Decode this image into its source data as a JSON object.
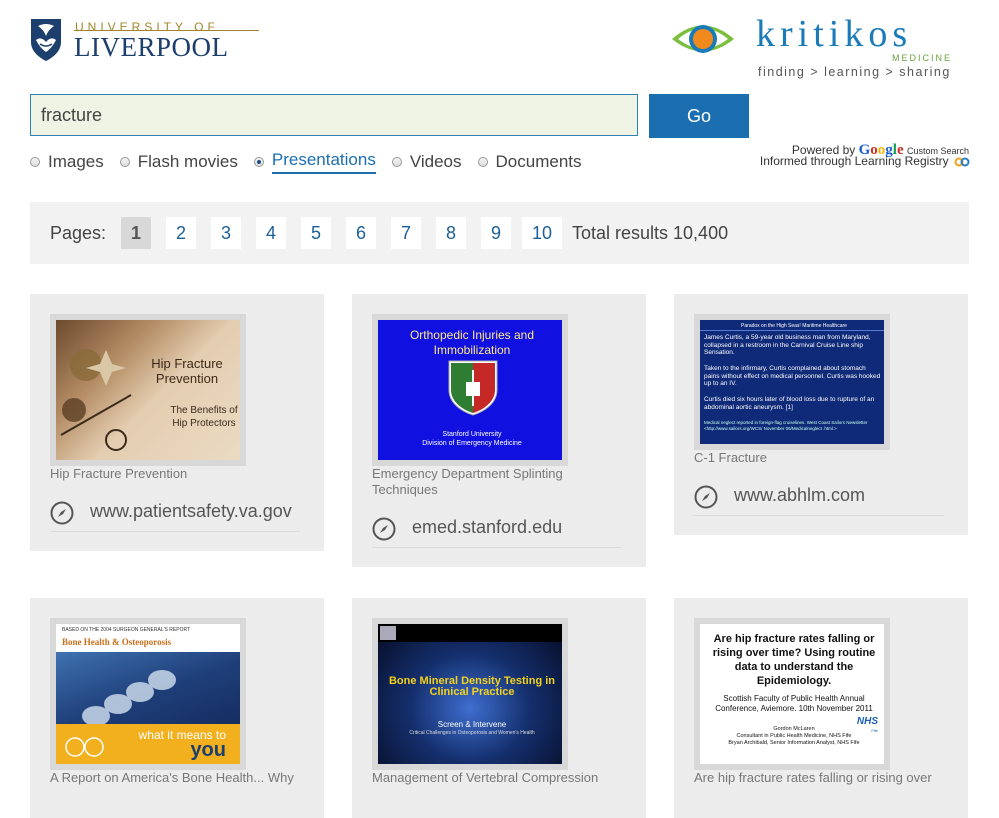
{
  "header": {
    "uol": {
      "top_text": "UNIVERSITY OF",
      "main_text": "LIVERPOOL"
    },
    "kritikos": {
      "word": "kritikos",
      "sub": "MEDICINE",
      "tagline": "finding > learning > sharing"
    }
  },
  "search": {
    "value": "fracture",
    "go_label": "Go"
  },
  "powered": {
    "prefix": "Powered by",
    "google": "Google",
    "custom": "Custom Search",
    "informed": "Informed through Learning Registry"
  },
  "filters": [
    {
      "label": "Images",
      "selected": false
    },
    {
      "label": "Flash movies",
      "selected": false
    },
    {
      "label": "Presentations",
      "selected": true
    },
    {
      "label": "Videos",
      "selected": false
    },
    {
      "label": "Documents",
      "selected": false
    }
  ],
  "pager": {
    "label": "Pages:",
    "pages": [
      "1",
      "2",
      "3",
      "4",
      "5",
      "6",
      "7",
      "8",
      "9",
      "10"
    ],
    "current": "1",
    "total": "Total results 10,400"
  },
  "results": [
    {
      "title": "Hip Fracture Prevention",
      "source": "www.patientsafety.va.gov",
      "slide": {
        "title": "Hip Fracture Prevention",
        "sub": "The Benefits of Hip Protectors"
      }
    },
    {
      "title": "Emergency Department Splinting Techniques",
      "source": "emed.stanford.edu",
      "slide": {
        "title": "Orthopedic Injuries and Immobilization",
        "sub1": "Stanford University",
        "sub2": "Division of Emergency Medicine"
      }
    },
    {
      "title": "C-1 Fracture",
      "source": "www.abhlm.com",
      "slide": {
        "header": "Paradox on the High Seas!   Maritime Healthcare",
        "p1": "James Curtis, a 59-year old business man from Maryland, collapsed in a restroom in the Carnival Cruise Line ship Sensation.",
        "p2": "Taken to the infirmary, Curtis complained about stomach pains without effect on medical personnel.  Curtis was hooked up to an IV.",
        "p3": "Curtis died six hours later of blood loss due to rupture of an abdominal aortic aneurysm.  [1]",
        "p4": "Medical neglect reported in foreign-flag cruiselines. West Coast Sailors Newsletter <http://www.sailors.org/WCS/ November 06/Medicalneglect .html.>"
      }
    },
    {
      "title": "A Report on America's Bone Health... Why",
      "source": "",
      "slide": {
        "top": "BASED ON THE 2004 SURGEON GENERAL'S REPORT",
        "title": "Bone Health & Osteoporosis",
        "what": "what it means to",
        "you": "you"
      }
    },
    {
      "title": "Management of Vertebral Compression",
      "source": "",
      "slide": {
        "title": "Bone Mineral Density Testing in Clinical Practice",
        "sub": "Screen & Intervene",
        "sub2": "Critical Challenges in Osteoporosis and Women's Health"
      }
    },
    {
      "title": "Are hip fracture rates falling or rising over",
      "source": "",
      "slide": {
        "title": "Are hip fracture rates falling or rising over time? Using routine data to understand the Epidemiology.",
        "conf": "Scottish Faculty of Public Health Annual Conference, Aviemore.  10th November 2011",
        "nhs": "NHS",
        "fife": "Fife",
        "a1": "Gordon McLaren",
        "a2": "Consultant in Public Health Medicine, NHS Fife",
        "a3": "Bryan Archibald, Senior Information Analyst, NHS Fife"
      }
    }
  ],
  "colors": {
    "brand_blue": "#1b6fb0",
    "card_bg": "#ececec",
    "pager_bg": "#f2f2f2"
  }
}
